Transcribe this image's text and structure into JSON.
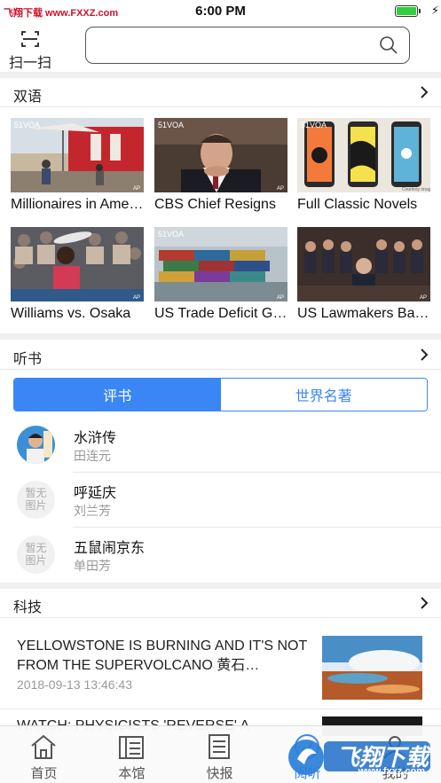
{
  "status_bar": {
    "watermark": "飞翔下载 www.FXXZ.com",
    "time": "6:00 PM"
  },
  "header": {
    "scan_label": "扫一扫",
    "search_value": "",
    "search_placeholder": ""
  },
  "bilingual": {
    "title": "双语",
    "items": [
      {
        "title": "Millionaires in America"
      },
      {
        "title": "CBS Chief Resigns"
      },
      {
        "title": "Full Classic Novels"
      },
      {
        "title": "Williams vs. Osaka"
      },
      {
        "title": "US Trade Deficit Grows"
      },
      {
        "title": "US Lawmakers Battle"
      }
    ]
  },
  "audiobooks": {
    "title": "听书",
    "tabs": [
      {
        "label": "评书",
        "active": true
      },
      {
        "label": "世界名著",
        "active": false
      }
    ],
    "books": [
      {
        "title": "水浒传",
        "author": "田连元",
        "avatar": "image"
      },
      {
        "title": "呼延庆",
        "author": "刘兰芳",
        "avatar": "暂无图片"
      },
      {
        "title": "五鼠闹京东",
        "author": "单田芳",
        "avatar": "暂无图片"
      }
    ],
    "placeholder_line1": "暂无",
    "placeholder_line2": "图片"
  },
  "tech": {
    "title": "科技",
    "articles": [
      {
        "title": "YELLOWSTONE IS BURNING AND IT'S NOT FROM THE SUPERVOLCANO 黄石…",
        "time": "2018-09-13 13:46:43"
      },
      {
        "title": "WATCH: PHYSICISTS 'REVERSE' A"
      }
    ]
  },
  "tabbar": {
    "items": [
      {
        "label": "首页",
        "icon": "home-icon",
        "active": false
      },
      {
        "label": "本馆",
        "icon": "library-icon",
        "active": false
      },
      {
        "label": "快报",
        "icon": "news-icon",
        "active": false
      },
      {
        "label": "阅听",
        "icon": "read-listen-icon",
        "active": true
      },
      {
        "label": "我的",
        "icon": "profile-icon",
        "active": false
      }
    ]
  },
  "watermark_logo": {
    "text": "飞翔下载",
    "site": "www.fxxz.com"
  },
  "colors": {
    "accent": "#3b86f5",
    "battery": "#2fcf3d",
    "watermark": "#d0102a"
  }
}
